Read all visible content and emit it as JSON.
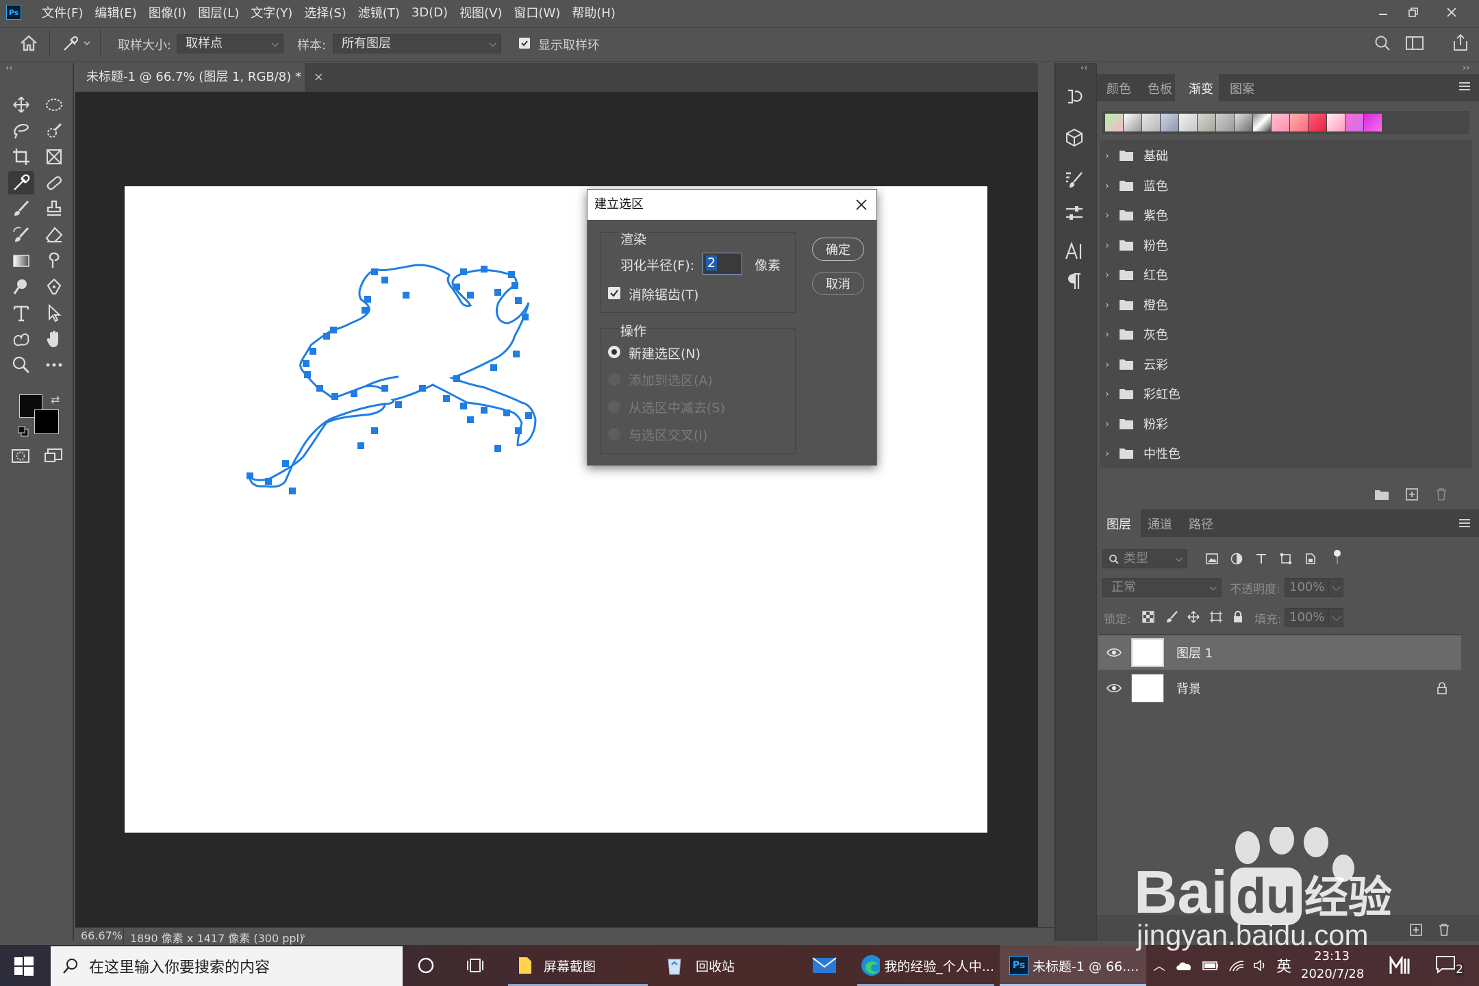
{
  "app": {
    "logo_text": "Ps",
    "menu": [
      "文件(F)",
      "编辑(E)",
      "图像(I)",
      "图层(L)",
      "文字(Y)",
      "选择(S)",
      "滤镜(T)",
      "3D(D)",
      "视图(V)",
      "窗口(W)",
      "帮助(H)"
    ]
  },
  "options": {
    "sample_size_label": "取样大小:",
    "sample_size_value": "取样点",
    "sample_label": "样本:",
    "sample_value": "所有图层",
    "show_ring_label": "显示取样环",
    "show_ring_checked": true
  },
  "document": {
    "tab_title": "未标题-1 @ 66.7% (图层 1, RGB/8) *",
    "zoom": "66.67%",
    "info": "1890 像素 x 1417 像素 (300 ppl)"
  },
  "dialog": {
    "title": "建立选区",
    "render_group": "渲染",
    "feather_label": "羽化半径(F):",
    "feather_value": "2",
    "feather_unit": "像素",
    "antialias_label": "消除锯齿(T)",
    "antialias_checked": true,
    "operation_group": "操作",
    "operations": [
      {
        "label": "新建选区(N)",
        "selected": true,
        "enabled": true
      },
      {
        "label": "添加到选区(A)",
        "selected": false,
        "enabled": false
      },
      {
        "label": "从选区中减去(S)",
        "selected": false,
        "enabled": false
      },
      {
        "label": "与选区交叉(I)",
        "selected": false,
        "enabled": false
      }
    ],
    "ok_label": "确定",
    "cancel_label": "取消"
  },
  "gradient_panel": {
    "tabs": [
      "颜色",
      "色板",
      "渐变",
      "图案"
    ],
    "active_tab": "渐变",
    "folders": [
      "基础",
      "蓝色",
      "紫色",
      "粉色",
      "红色",
      "橙色",
      "灰色",
      "云彩",
      "彩虹色",
      "粉彩",
      "中性色"
    ]
  },
  "layers_panel": {
    "tabs": [
      "图层",
      "通道",
      "路径"
    ],
    "active_tab": "图层",
    "filter_placeholder": "类型",
    "blend_mode": "正常",
    "opacity_label": "不透明度:",
    "opacity_value": "100%",
    "lock_label": "锁定:",
    "fill_label": "填充:",
    "fill_value": "100%",
    "layers": [
      {
        "name": "图层 1",
        "selected": true,
        "locked": false
      },
      {
        "name": "背景",
        "selected": false,
        "locked": true
      }
    ]
  },
  "taskbar": {
    "search_placeholder": "在这里输入你要搜索的内容",
    "apps": [
      "屏幕截图",
      "回收站",
      "我的经验_个人中...",
      "未标题-1 @ 66...."
    ],
    "ime": "英",
    "time": "23:13",
    "date": "2020/7/28",
    "notification_count": "2"
  },
  "watermark": {
    "brand": "Bai",
    "brand2": "du",
    "cn": "经验",
    "url": "jingyan.baidu.com"
  },
  "colors": {
    "accent_path": "#1e7ee6",
    "panel_bg": "#535353",
    "doc_bg": "#282828"
  }
}
